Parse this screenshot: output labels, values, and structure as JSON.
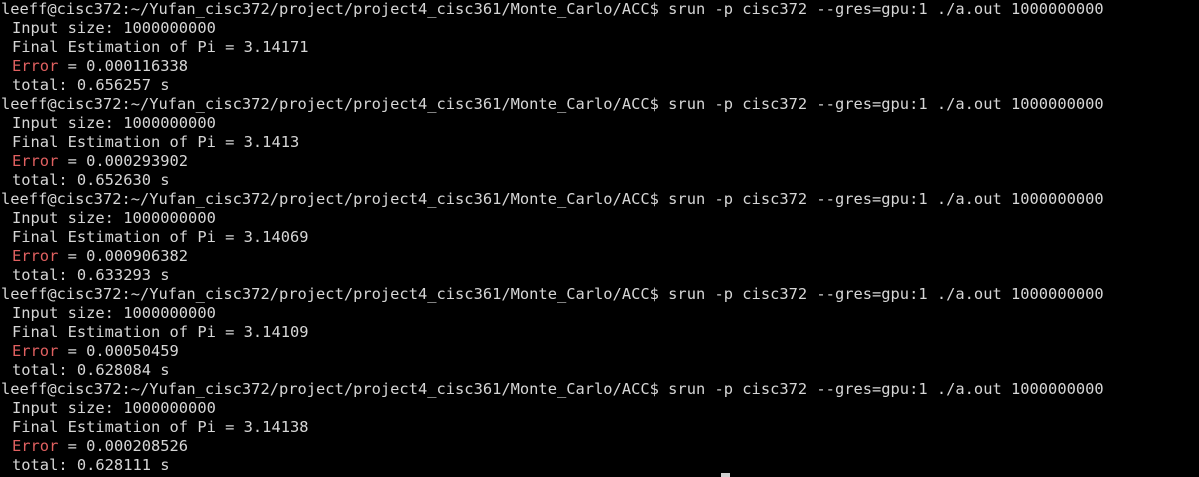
{
  "terminal": {
    "prompt": "leeff@cisc372:~/Yufan_cisc372/project/project4_cisc361/Monte_Carlo/ACC$",
    "command": " srun -p cisc372 --gres=gpu:1 ./a.out 1000000000",
    "runs": [
      {
        "input_size": "Input size: 1000000000",
        "estimation": "Final Estimation of Pi = 3.14171",
        "error_label": "Error",
        "error_value": " = 0.000116338",
        "total": "total: 0.656257 s"
      },
      {
        "input_size": "Input size: 1000000000",
        "estimation": "Final Estimation of Pi = 3.1413",
        "error_label": "Error",
        "error_value": " = 0.000293902",
        "total": "total: 0.652630 s"
      },
      {
        "input_size": "Input size: 1000000000",
        "estimation": "Final Estimation of Pi = 3.14069",
        "error_label": "Error",
        "error_value": " = 0.000906382",
        "total": "total: 0.633293 s"
      },
      {
        "input_size": "Input size: 1000000000",
        "estimation": "Final Estimation of Pi = 3.14109",
        "error_label": "Error",
        "error_value": " = 0.00050459",
        "total": "total: 0.628084 s"
      },
      {
        "input_size": "Input size: 1000000000",
        "estimation": "Final Estimation of Pi = 3.14138",
        "error_label": "Error",
        "error_value": " = 0.000208526",
        "total": "total: 0.628111 s"
      }
    ]
  },
  "colors": {
    "background": "#000000",
    "text": "#d6d6d6",
    "error_label": "#e06060"
  }
}
